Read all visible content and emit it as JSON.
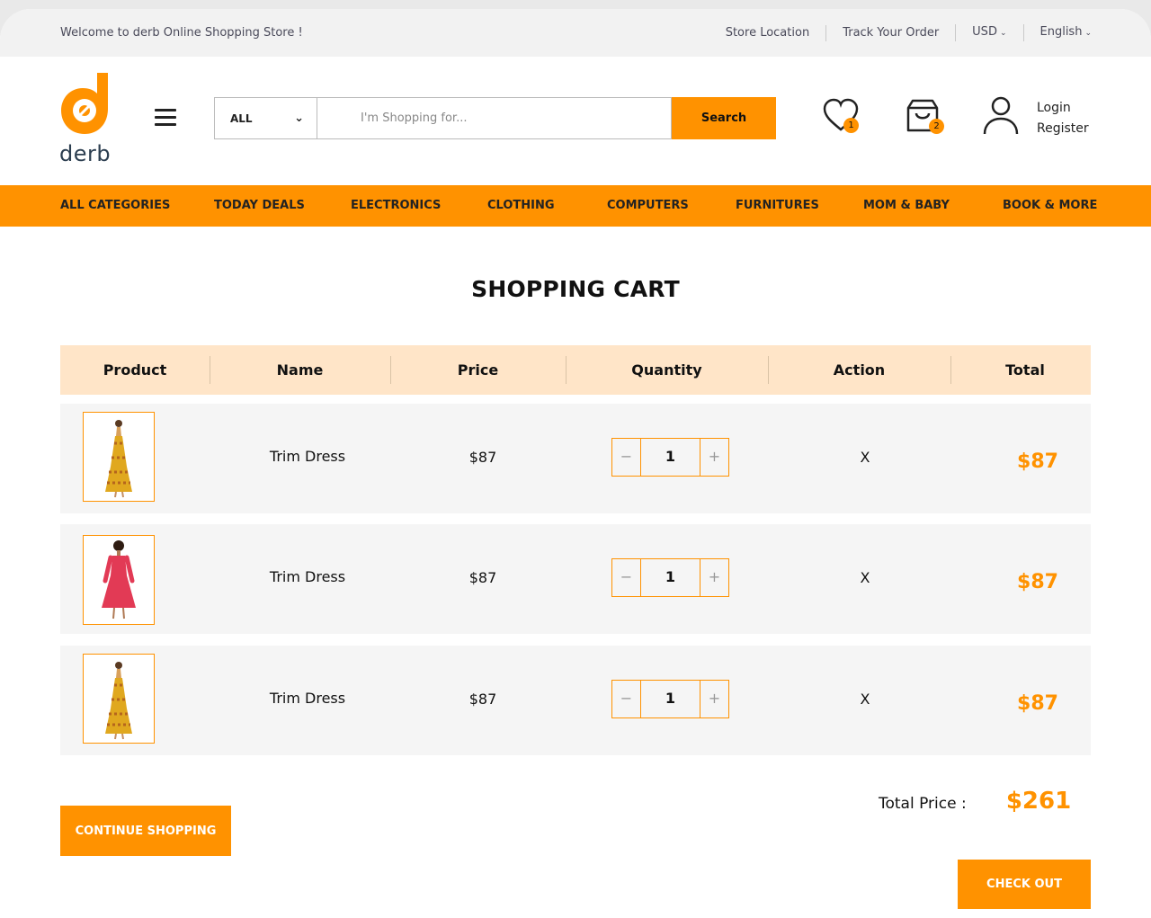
{
  "topbar": {
    "welcome": "Welcome to derb Online Shopping Store !",
    "store_location": "Store Location",
    "track_order": "Track Your Order",
    "currency": "USD",
    "language": "English"
  },
  "brand": {
    "name": "derb",
    "accent": "#ff9200",
    "dark": "#2c3e50"
  },
  "search": {
    "category": "ALL",
    "placeholder": "I'm Shopping for...",
    "button": "Search"
  },
  "header": {
    "wishlist_count": "1",
    "cart_count": "2",
    "login": "Login",
    "register": "Register"
  },
  "nav": [
    "ALL CATEGORIES",
    "TODAY DEALS",
    "ELECTRONICS",
    "CLOTHING",
    "COMPUTERS",
    "FURNITURES",
    "MOM & BABY",
    "BOOK & MORE"
  ],
  "page_title": "SHOPPING CART",
  "table": {
    "headers": [
      "Product",
      "Name",
      "Price",
      "Quantity",
      "Action",
      "Total"
    ],
    "rows": [
      {
        "image": "dress-yellow-image",
        "name": "Trim Dress",
        "price": "$87",
        "qty": "1",
        "action": "X",
        "total": "$87"
      },
      {
        "image": "dress-pink-image",
        "name": "Trim Dress",
        "price": "$87",
        "qty": "1",
        "action": "X",
        "total": "$87"
      },
      {
        "image": "dress-yellow-image",
        "name": "Trim Dress",
        "price": "$87",
        "qty": "1",
        "action": "X",
        "total": "$87"
      }
    ]
  },
  "minus": "−",
  "plus": "+",
  "summary": {
    "label": "Total Price :",
    "value": "$261"
  },
  "buttons": {
    "continue": "CONTINUE SHOPPING",
    "checkout": "CHECK OUT"
  }
}
